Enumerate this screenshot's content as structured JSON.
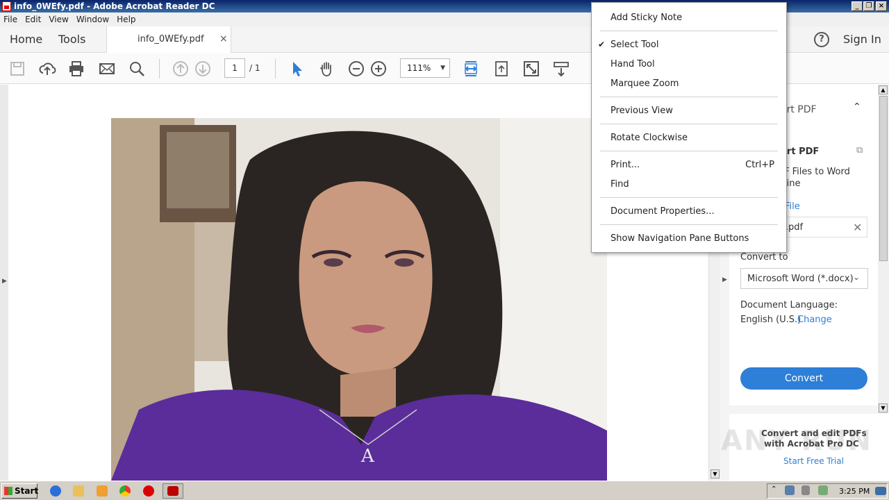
{
  "window": {
    "title": "info_0WEfy.pdf - Adobe Acrobat Reader DC"
  },
  "menubar": [
    "File",
    "Edit",
    "View",
    "Window",
    "Help"
  ],
  "tabs": {
    "home": "Home",
    "tools": "Tools",
    "document": "info_0WEfy.pdf",
    "sign_in": "Sign In"
  },
  "toolbar": {
    "page_current": "1",
    "page_total": "/ 1",
    "zoom": "111%"
  },
  "context_menu": {
    "items": [
      {
        "label": "Add Sticky Note"
      },
      {
        "label": "Select Tool",
        "checked": true
      },
      {
        "label": "Hand Tool"
      },
      {
        "label": "Marquee Zoom"
      },
      {
        "label": "Previous View"
      },
      {
        "label": "Rotate Clockwise"
      },
      {
        "label": "Print...",
        "shortcut": "Ctrl+P"
      },
      {
        "label": "Find"
      },
      {
        "label": "Document Properties..."
      },
      {
        "label": "Show Navigation Pane Buttons"
      }
    ]
  },
  "right_pane": {
    "header": "ort PDF",
    "section_title": "ort PDF",
    "description_line1": "F Files to Word",
    "description_line2": "line",
    "select_file_link": "File",
    "file_name": "y.pdf",
    "convert_to_label": "Convert to",
    "convert_to_value": "Microsoft Word (*.docx)",
    "doc_language_label": "Document Language:",
    "doc_language_value": "English (U.S.)",
    "change_link": "Change",
    "convert_button": "Convert",
    "promo_line1": "Convert and edit PDFs",
    "promo_line2": "with Acrobat Pro DC",
    "promo_link": "Start Free Trial"
  },
  "taskbar": {
    "start": "Start",
    "clock": "3:25 PM"
  },
  "watermark": "ANY RUN",
  "colors": {
    "accent": "#2d7fd8",
    "title_bar": "#0a246a",
    "toolbar_icon": "#555555"
  }
}
